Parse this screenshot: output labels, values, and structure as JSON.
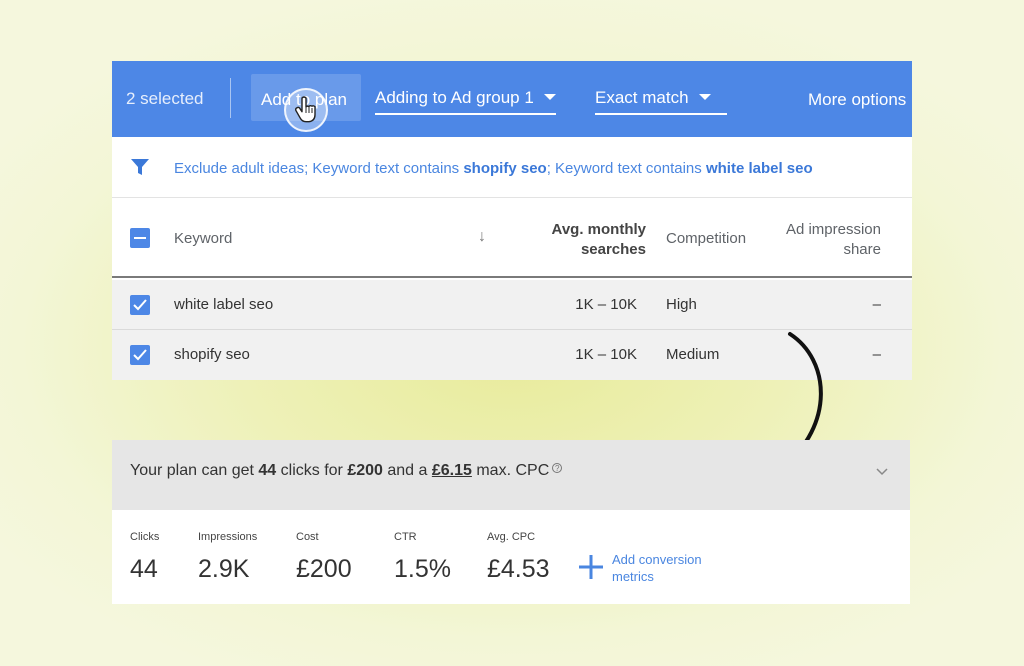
{
  "toolbar": {
    "selected_text": "2 selected",
    "add_to_plan_label": "Add to plan",
    "ad_group_dropdown": "Adding to Ad group 1",
    "match_dropdown": "Exact match",
    "more_options": "More options"
  },
  "filter": {
    "prefix": "Exclude adult ideas; Keyword text contains ",
    "term1": "shopify seo",
    "middle": "; Keyword text contains ",
    "term2": "white label seo"
  },
  "table": {
    "headers": {
      "keyword": "Keyword",
      "sort_icon": "↓",
      "avg_line1": "Avg. monthly",
      "avg_line2": "searches",
      "competition": "Competition",
      "share_line1": "Ad impression",
      "share_line2": "share"
    },
    "rows": [
      {
        "keyword": "white label seo",
        "searches": "1K – 10K",
        "competition": "High",
        "share": "–",
        "checked": true
      },
      {
        "keyword": "shopify seo",
        "searches": "1K – 10K",
        "competition": "Medium",
        "share": "–",
        "checked": true
      }
    ]
  },
  "plan": {
    "t1": "Your plan can get ",
    "clicks": "44",
    "t2": " clicks for ",
    "cost": "£200",
    "t3": " and a ",
    "max_cpc": "£6.15",
    "t4": " max. CPC",
    "help_icon": "?"
  },
  "metrics": [
    {
      "label": "Clicks",
      "value": "44"
    },
    {
      "label": "Impressions",
      "value": "2.9K"
    },
    {
      "label": "Cost",
      "value": "£200"
    },
    {
      "label": "CTR",
      "value": "1.5%"
    },
    {
      "label": "Avg. CPC",
      "value": "£4.53"
    }
  ],
  "add_conversion": {
    "line1": "Add conversion",
    "line2": "metrics"
  },
  "colors": {
    "accent": "#4d87e6",
    "link": "#4a86e0",
    "background": "#eef1b8"
  },
  "icons": [
    "filter-icon",
    "hand-cursor-icon",
    "checkbox-icon",
    "sort-arrow-icon",
    "chevron-down-icon",
    "plus-icon",
    "help-icon",
    "curved-arrow-icon"
  ]
}
